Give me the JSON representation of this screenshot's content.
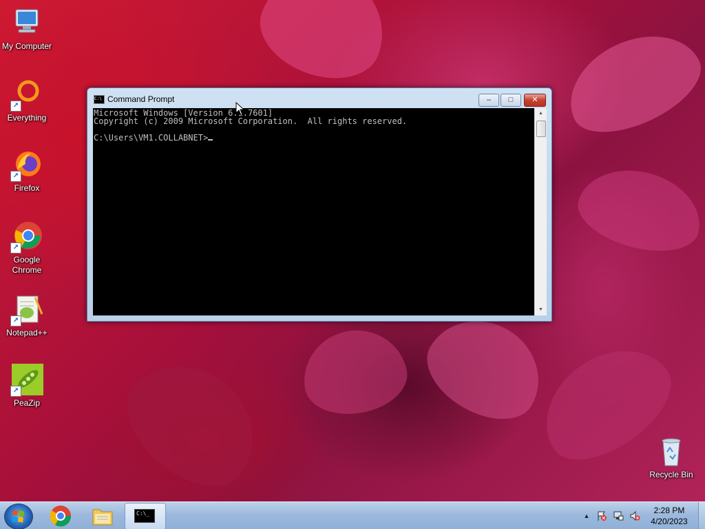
{
  "desktop": {
    "icons": [
      {
        "label": "My Computer",
        "icon": "computer-icon"
      },
      {
        "label": "Everything",
        "icon": "everything-icon"
      },
      {
        "label": "Firefox",
        "icon": "firefox-icon"
      },
      {
        "label": "Google Chrome",
        "icon": "chrome-icon"
      },
      {
        "label": "Notepad++",
        "icon": "notepadpp-icon"
      },
      {
        "label": "PeaZip",
        "icon": "peazip-icon"
      },
      {
        "label": "Recycle Bin",
        "icon": "recycle-bin-icon"
      }
    ]
  },
  "cmd_window": {
    "title": "Command Prompt",
    "icon_text": "C:\\",
    "minimize": "–",
    "maximize": "□",
    "close": "✕",
    "lines": [
      "Microsoft Windows [Version 6.1.7601]",
      "Copyright (c) 2009 Microsoft Corporation.  All rights reserved.",
      "",
      "C:\\Users\\VM1.COLLABNET>"
    ]
  },
  "taskbar": {
    "start_icon": "windows-start-icon",
    "pinned": [
      {
        "name": "chrome",
        "icon": "chrome-icon"
      },
      {
        "name": "explorer",
        "icon": "folder-icon"
      },
      {
        "name": "cmd",
        "icon": "cmd-icon",
        "text": "C:\\_"
      }
    ],
    "tray": {
      "time": "2:28 PM",
      "date": "4/20/2023"
    }
  },
  "colors": {
    "wallpaper_primary": "#c8122c",
    "wallpaper_secondary": "#b3245a",
    "taskbar": "#9cb9dd",
    "console_bg": "#000000",
    "console_fg": "#c0c0c0"
  }
}
